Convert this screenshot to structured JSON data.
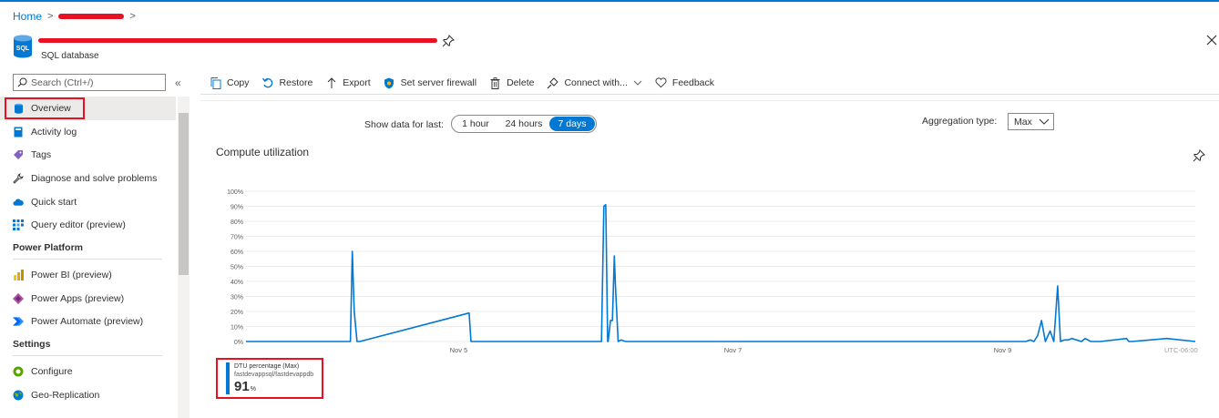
{
  "breadcrumb": {
    "home": "Home",
    "sep": ">"
  },
  "header": {
    "icon_label": "SQL",
    "resource_type": "SQL database"
  },
  "sidebar": {
    "search_placeholder": "Search (Ctrl+/)",
    "collapse": "«",
    "items": [
      {
        "label": "Overview",
        "icon": "sql-database-icon",
        "color": "#0078d4"
      },
      {
        "label": "Activity log",
        "icon": "activity-log-icon",
        "color": "#0078d4"
      },
      {
        "label": "Tags",
        "icon": "tag-icon",
        "color": "#8661c5"
      },
      {
        "label": "Diagnose and solve problems",
        "icon": "wrench-icon",
        "color": "#323130"
      },
      {
        "label": "Quick start",
        "icon": "cloud-icon",
        "color": "#0078d4"
      },
      {
        "label": "Query editor (preview)",
        "icon": "grid-icon",
        "color": "#0078d4"
      }
    ],
    "section_power": "Power Platform",
    "power_items": [
      {
        "label": "Power BI (preview)",
        "icon": "power-bi-icon",
        "color": "#f2c811"
      },
      {
        "label": "Power Apps (preview)",
        "icon": "power-apps-icon",
        "color": "#742774"
      },
      {
        "label": "Power Automate (preview)",
        "icon": "power-automate-icon",
        "color": "#0066ff"
      }
    ],
    "section_settings": "Settings",
    "settings_items": [
      {
        "label": "Configure",
        "icon": "configure-icon",
        "color": "#57a300"
      },
      {
        "label": "Geo-Replication",
        "icon": "globe-icon",
        "color": "#0078d4"
      }
    ]
  },
  "toolbar": {
    "copy": "Copy",
    "restore": "Restore",
    "export": "Export",
    "firewall": "Set server firewall",
    "delete": "Delete",
    "connect": "Connect with...",
    "feedback": "Feedback"
  },
  "time_controls": {
    "label": "Show data for last:",
    "options": [
      "1 hour",
      "24 hours",
      "7 days"
    ],
    "selected": "7 days"
  },
  "aggregation": {
    "label": "Aggregation type:",
    "value": "Max"
  },
  "chart_data": {
    "type": "line",
    "title": "Compute utilization",
    "ylim": [
      0,
      100
    ],
    "yticks": [
      "100%",
      "90%",
      "80%",
      "70%",
      "60%",
      "50%",
      "40%",
      "30%",
      "20%",
      "10%",
      "0%"
    ],
    "xtick_labels": [
      "Nov 5",
      "Nov 7",
      "Nov 9",
      "UTC-06:00"
    ],
    "grid": true,
    "series": [
      {
        "name": "DTU percentage (Max)",
        "color": "#0078d4",
        "x": [
          0,
          0.11,
          0.112,
          0.114,
          0.117,
          0.12,
          0.235,
          0.237,
          0.24,
          0.3745,
          0.377,
          0.379,
          0.381,
          0.3815,
          0.384,
          0.386,
          0.388,
          0.389,
          0.392,
          0.395,
          0.4,
          0.8215,
          0.826,
          0.83,
          0.834,
          0.838,
          0.842,
          0.847,
          0.851,
          0.855,
          0.858,
          0.862,
          0.866,
          0.87,
          0.88,
          0.884,
          0.89,
          0.9,
          0.9275,
          0.93,
          0.933,
          0.97,
          1.0
        ],
        "y": [
          0,
          0,
          60,
          20,
          0,
          0,
          19,
          0,
          0,
          0,
          90,
          91,
          0,
          0,
          14,
          14,
          57,
          40,
          0,
          1,
          0,
          0,
          1,
          0,
          4,
          14,
          0,
          7,
          0,
          37,
          0,
          1,
          1,
          2,
          0,
          2,
          0,
          0,
          2,
          0,
          0,
          2,
          0
        ]
      }
    ]
  },
  "legend": {
    "series": "DTU percentage (Max)",
    "resource": "fastdevappsql/fastdevappdb",
    "value": "91",
    "unit": "%"
  }
}
